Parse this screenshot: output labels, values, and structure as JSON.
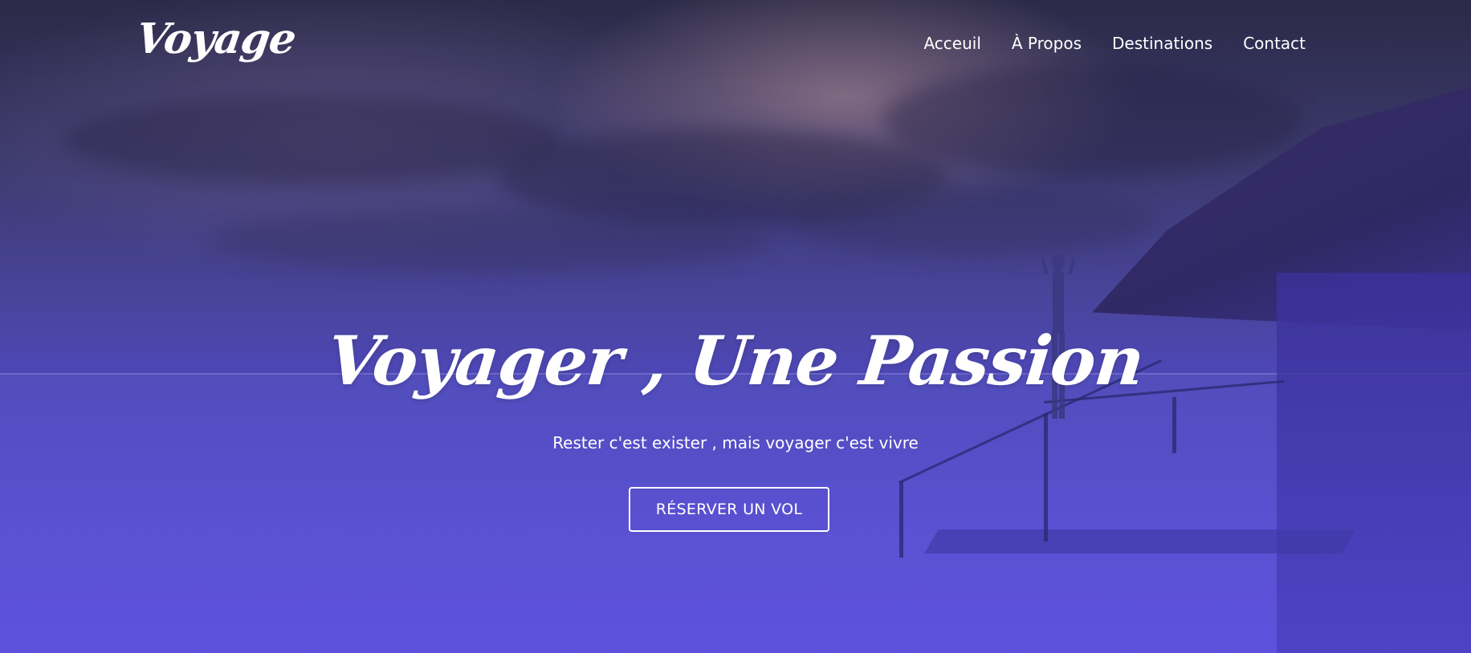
{
  "brand": {
    "logo_text": "Voyage"
  },
  "nav": {
    "items": [
      {
        "label": "Acceuil"
      },
      {
        "label": "À Propos"
      },
      {
        "label": "Destinations"
      },
      {
        "label": "Contact"
      }
    ]
  },
  "hero": {
    "headline": "Voyager , Une Passion",
    "tagline": "Rester c'est exister , mais voyager c'est vivre",
    "cta_label": "RÉSERVER UN VOL"
  },
  "colors": {
    "overlay_top": "#2b2a47",
    "overlay_bottom": "#5d52dd",
    "text": "#ffffff"
  }
}
